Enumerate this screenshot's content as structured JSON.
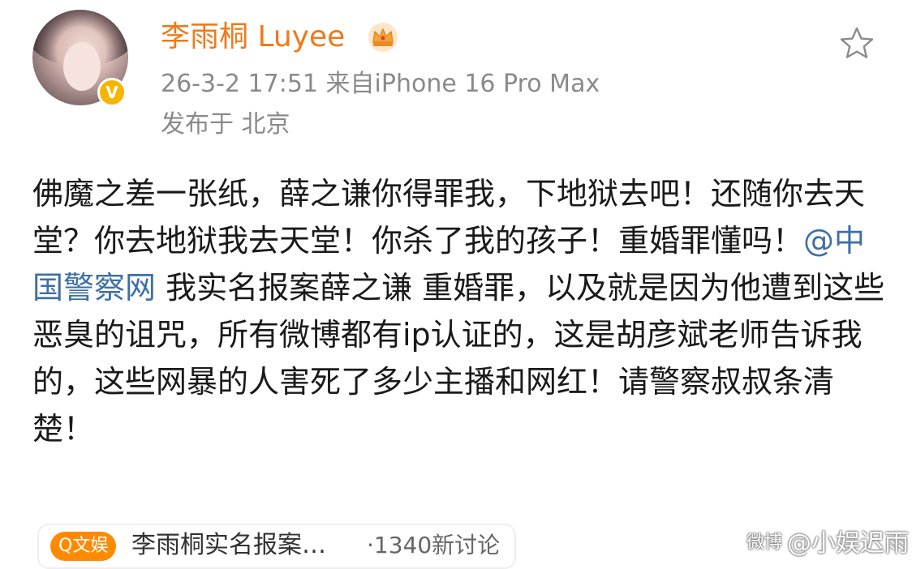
{
  "profile": {
    "username": "李雨桐 Luyee",
    "verified_badge": "V"
  },
  "meta": {
    "timestamp": "26-3-2 17:51",
    "source": "来自iPhone 16 Pro Max",
    "location": "发布于 北京"
  },
  "post": {
    "text_part1": "佛魔之差一张纸，薛之谦你得罪我，下地狱去吧！还随你去天堂？你去地狱我去天堂！你杀了我的孩子！重婚罪懂吗！",
    "mention": "@中国警察网",
    "text_part2": " 我实名报案薛之谦 重婚罪，以及就是因为他遭到这些恶臭的诅咒，所有微博都有ip认证的，这是胡彦斌老师告诉我的，这些网暴的人害死了多少主播和网红！请警察叔叔条清楚！"
  },
  "topic": {
    "tag": "Q文娱",
    "title": "李雨桐实名报案…",
    "count": "·1340新讨论"
  },
  "watermark": {
    "logo_text": "微博",
    "text": "@小娱迟雨"
  },
  "icons": {
    "favorite": "star-outline-icon",
    "crown": "crown-icon"
  },
  "colors": {
    "username": "#ef7a1a",
    "mention": "#3d6fa8",
    "meta": "#8a8a8a",
    "verified": "#f7b500",
    "topic_tag": "#ff8a00"
  }
}
